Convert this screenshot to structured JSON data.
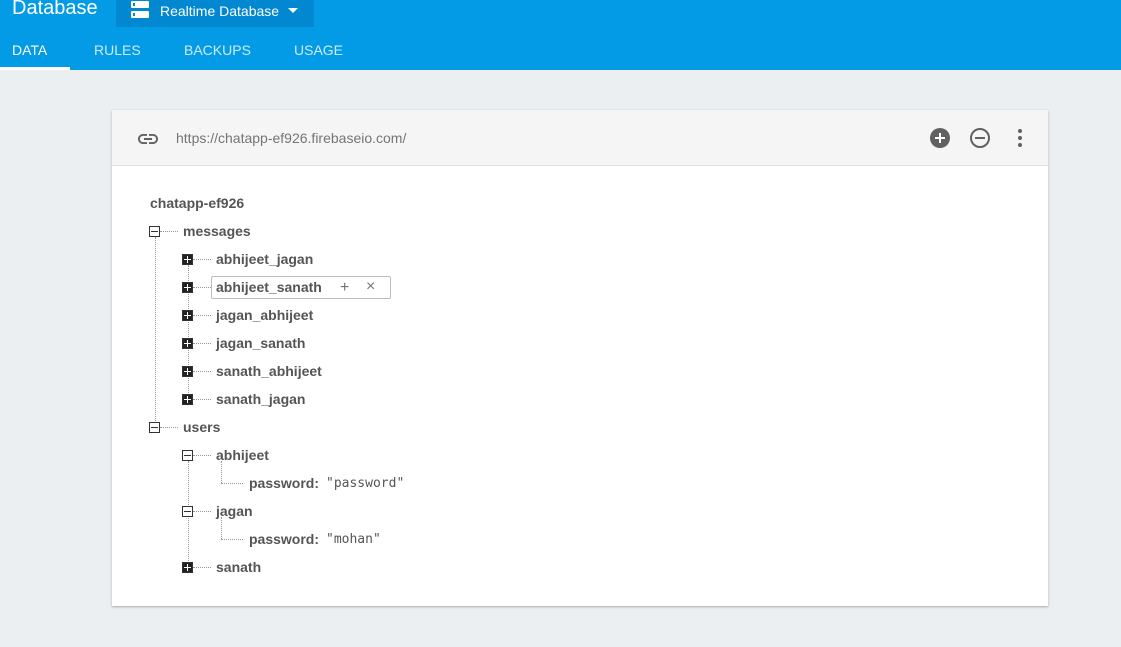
{
  "header": {
    "title": "Database",
    "db_selector": "Realtime Database",
    "tabs": [
      "DATA",
      "RULES",
      "BACKUPS",
      "USAGE"
    ]
  },
  "toolbar": {
    "url": "https://chatapp-ef926.firebaseio.com/"
  },
  "tree": {
    "root": "chatapp-ef926",
    "messages": "messages",
    "message_children": [
      "abhijeet_jagan",
      "abhijeet_sanath",
      "jagan_abhijeet",
      "jagan_sanath",
      "sanath_abhijeet",
      "sanath_jagan"
    ],
    "users": "users",
    "user_abhijeet": "abhijeet",
    "user_abhijeet_key": "password:",
    "user_abhijeet_value": "\"password\"",
    "user_jagan": "jagan",
    "user_jagan_key": "password:",
    "user_jagan_value": "\"mohan\"",
    "user_sanath": "sanath"
  },
  "hover_actions": {
    "add": "+",
    "delete": "×"
  },
  "colors": {
    "header": "#039be5",
    "selector": "#0288d1",
    "background": "#eceff1"
  }
}
